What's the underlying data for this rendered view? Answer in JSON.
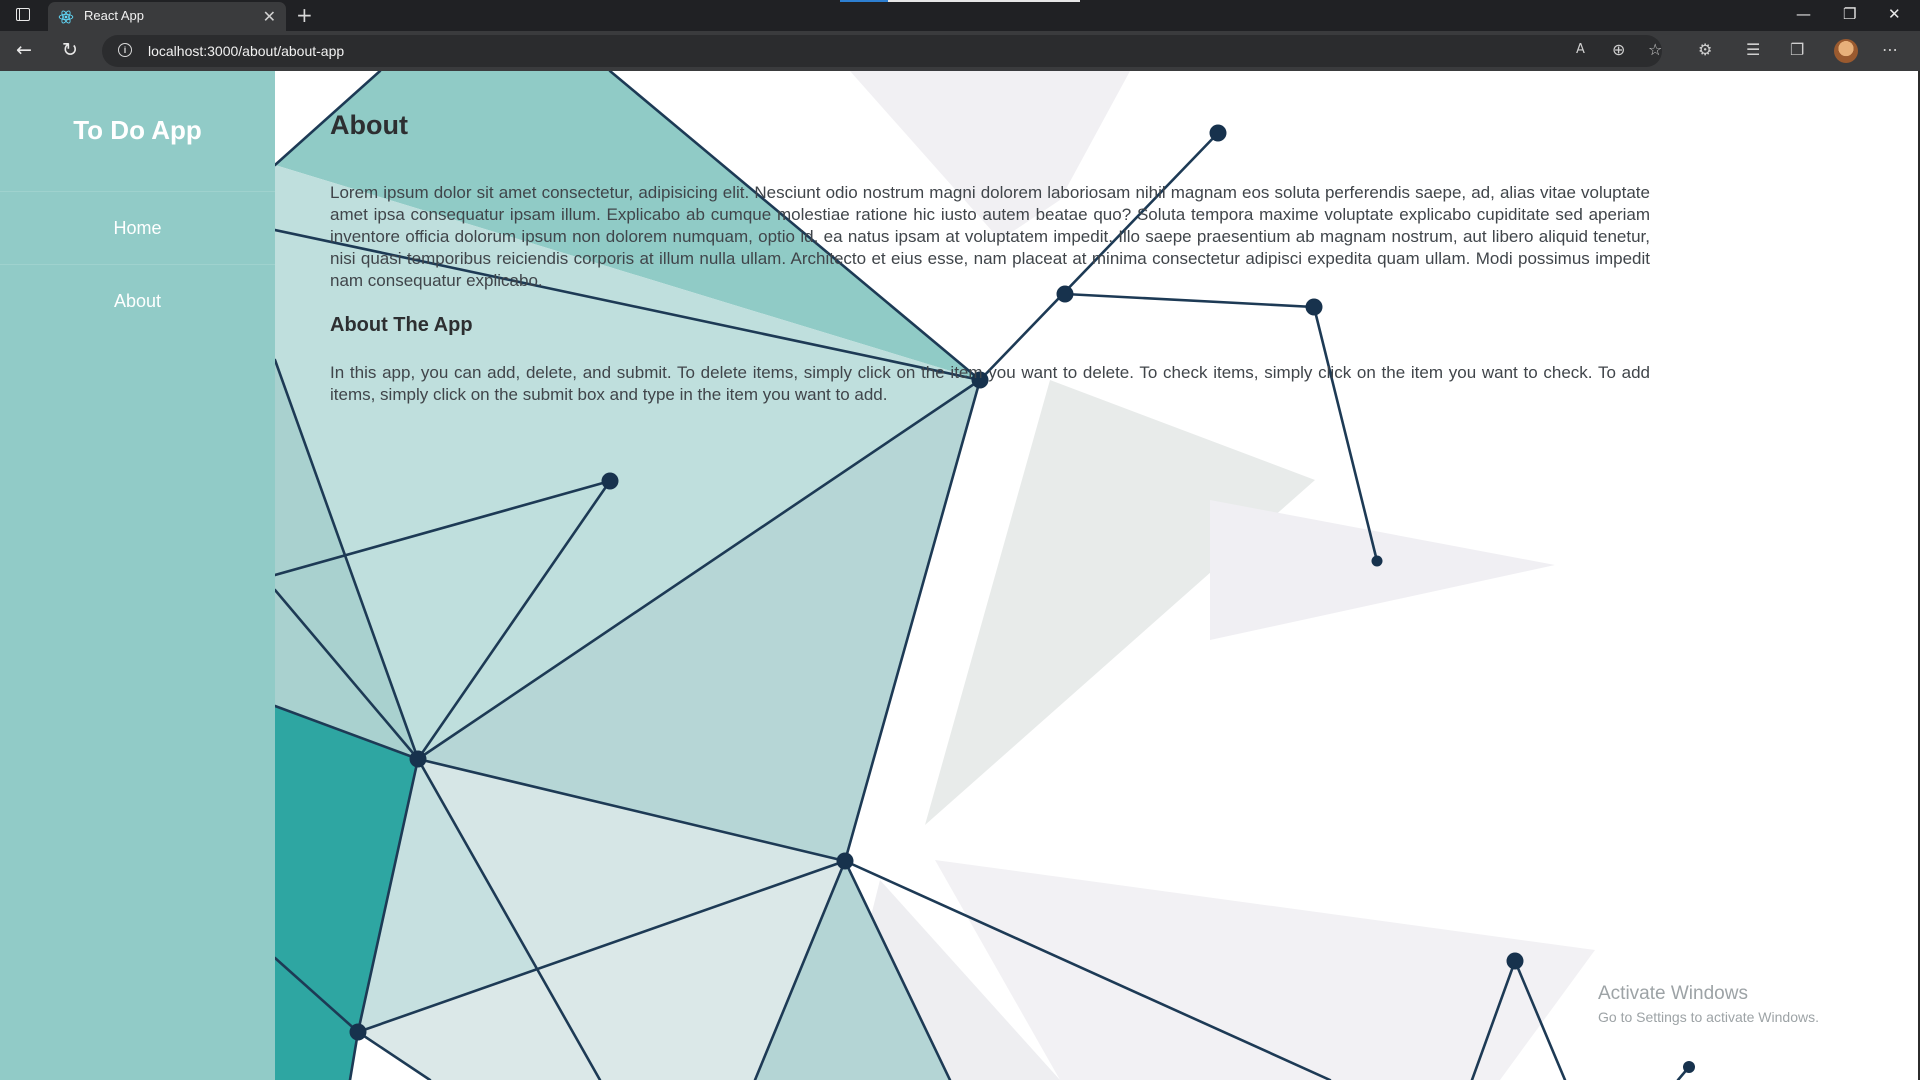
{
  "browser": {
    "tab_title": "React App",
    "tab_close": "✕",
    "new_tab": "+",
    "url": "localhost:3000/about/about-app",
    "info": "i",
    "window_controls": [
      "—",
      "❐",
      "✕"
    ]
  },
  "app": {
    "brand": "To Do App",
    "nav": [
      "Home",
      "About"
    ]
  },
  "main": {
    "title": "About",
    "intro": "Lorem ipsum dolor sit amet consectetur, adipisicing elit. Nesciunt odio nostrum magni dolorem laboriosam nihil magnam eos soluta perferendis saepe, ad, alias vitae voluptate amet ipsa consequatur ipsam illum. Explicabo ab cumque molestiae ratione hic iusto autem beatae quo? Soluta tempora maxime voluptate explicabo cupiditate sed aperiam inventore officia dolorum ipsum non dolorem numquam, optio id, ea natus ipsam at voluptatem impedit. Illo saepe praesentium ab magnam nostrum, aut libero aliquid tenetur, nisi quasi temporibus reiciendis corporis at illum nulla ullam. Architecto et eius esse, nam placeat at minima consectetur adipisci expedita quam ullam. Modi possimus impedit nam consequatur explicabo.",
    "section_title": "About The App",
    "section_text": "In this app, you can add, delete, and submit. To delete items, simply click on the item you want to delete. To check items, simply click on the item you want to check. To add items, simply click on the submit box and type in the item you want to add."
  },
  "watermark": {
    "line1": "Activate Windows",
    "line2": "Go to Settings to activate Windows."
  },
  "colors": {
    "sidebar": "#91cbc7",
    "teal_dark": "#2ea6a2",
    "node": "#17324d"
  }
}
